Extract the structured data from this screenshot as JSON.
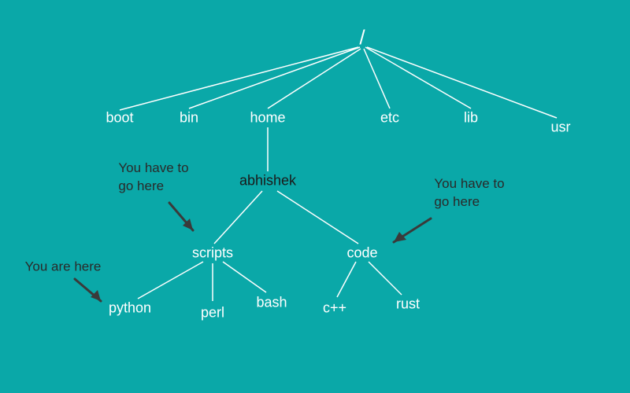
{
  "root": "/",
  "level1": {
    "boot": "boot",
    "bin": "bin",
    "home": "home",
    "etc": "etc",
    "lib": "lib",
    "usr": "usr"
  },
  "level2": {
    "abhishek": "abhishek"
  },
  "level3": {
    "scripts": "scripts",
    "code": "code"
  },
  "level4": {
    "python": "python",
    "perl": "perl",
    "bash": "bash",
    "cpp": "c++",
    "rust": "rust"
  },
  "annotations": {
    "gohere1": "You have to\ngo here",
    "gohere2": "You have to\ngo here",
    "youarehere": "You are here"
  }
}
